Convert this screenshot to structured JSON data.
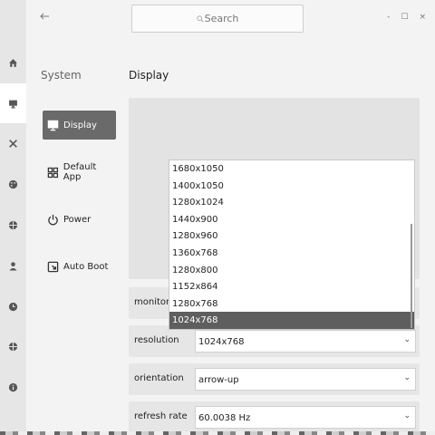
{
  "header": {
    "search_placeholder": "Search",
    "minimize": "-",
    "maximize": "☐",
    "close": "×"
  },
  "sidebar_title": "System",
  "pane_title": "Display",
  "nav": [
    {
      "label": "Display",
      "icon": "monitor-icon",
      "active": true
    },
    {
      "label": "Default App",
      "icon": "grid-icon",
      "active": false
    },
    {
      "label": "Power",
      "icon": "power-icon",
      "active": false
    },
    {
      "label": "Auto Boot",
      "icon": "autoboot-icon",
      "active": false
    }
  ],
  "rail_icons": [
    "home-icon",
    "display-icon",
    "tools-icon",
    "palette-icon",
    "globe-icon",
    "user-icon",
    "clock-icon",
    "crosshair-icon",
    "info-icon"
  ],
  "rows": {
    "monitor": {
      "label": "monitor"
    },
    "resolution": {
      "label": "resolution",
      "value": "1024x768"
    },
    "orientation": {
      "label": "orientation",
      "value": "arrow-up"
    },
    "refresh_rate": {
      "label": "refresh rate",
      "value": "60.0038 Hz"
    }
  },
  "resolution_options": [
    "1680x1050",
    "1400x1050",
    "1280x1024",
    "1440x900",
    "1280x960",
    "1360x768",
    "1280x800",
    "1152x864",
    "1280x768",
    "1024x768"
  ],
  "resolution_selected": "1024x768",
  "colors": {
    "accent": "#6a6a6a",
    "selected_option": "#5e5e5e"
  }
}
